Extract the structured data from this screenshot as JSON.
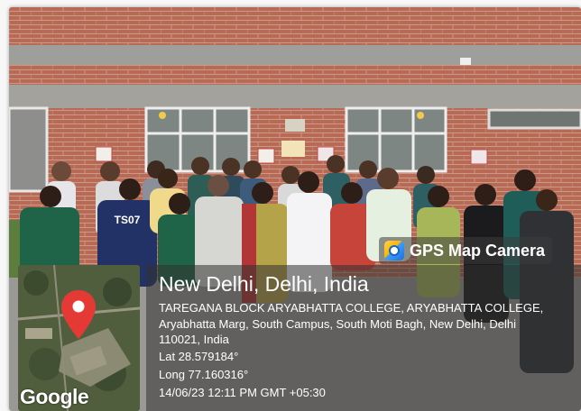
{
  "overlay": {
    "app_name": "GPS Map Camera",
    "location_title": "New Delhi, Delhi, India",
    "address_lines": [
      "TAREGANA BLOCK ARYABHATTA COLLEGE, ARYABHATTA COLLEGE,",
      "Aryabhatta Marg, South Campus, South Moti Bagh, New Delhi, Delhi",
      "110021, India"
    ],
    "latitude": "Lat 28.579184°",
    "longitude": "Long 77.160316°",
    "timestamp": "14/06/23 12:11 PM GMT +05:30",
    "map_provider": "Google"
  },
  "photo": {
    "shirt_text": "TS07"
  },
  "colors": {
    "brick": "#b86a55",
    "map_pin": "#e53935",
    "overlay_bg": "#333333"
  }
}
